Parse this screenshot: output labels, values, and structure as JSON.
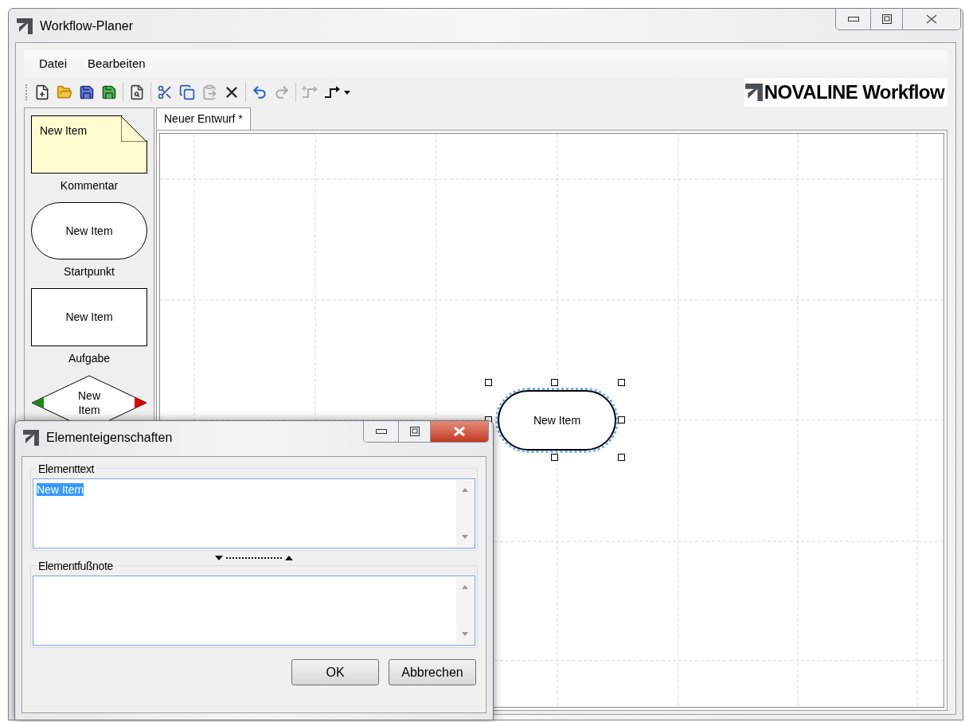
{
  "window": {
    "title": "Workflow-Planer"
  },
  "menu": [
    "Datei",
    "Bearbeiten"
  ],
  "toolbar": {
    "groups": [
      [
        {
          "kind": "new",
          "disabled": false
        },
        {
          "kind": "open",
          "disabled": false
        },
        {
          "kind": "save",
          "disabled": false
        },
        {
          "kind": "save-as",
          "disabled": false
        }
      ],
      [
        {
          "kind": "preview",
          "disabled": false
        }
      ],
      [
        {
          "kind": "cut",
          "disabled": false
        },
        {
          "kind": "copy",
          "disabled": false
        },
        {
          "kind": "paste",
          "disabled": true
        },
        {
          "kind": "delete",
          "disabled": false
        }
      ],
      [
        {
          "kind": "undo",
          "disabled": false
        },
        {
          "kind": "redo",
          "disabled": true
        }
      ],
      [
        {
          "kind": "connector-add",
          "disabled": true
        },
        {
          "kind": "connector",
          "disabled": false
        }
      ]
    ],
    "logo": "NOVALINE Workflow"
  },
  "palette": [
    {
      "kind": "comment",
      "text": "New Item",
      "label": "Kommentar"
    },
    {
      "kind": "start",
      "text": "New Item",
      "label": "Startpunkt"
    },
    {
      "kind": "task",
      "text": "New Item",
      "label": "Aufgabe"
    },
    {
      "kind": "decision",
      "text": "New Item"
    }
  ],
  "tabs": [
    {
      "label": "Neuer Entwurf *",
      "selected": true
    }
  ],
  "canvas": {
    "nodes": [
      {
        "kind": "start",
        "text": "New Item",
        "selected": true
      }
    ]
  },
  "dialog": {
    "title": "Elementeigenschaften",
    "fields": [
      {
        "label": "Elementtext",
        "value": "New Item",
        "highlighted": true
      },
      {
        "label": "Elementfußnote"
      }
    ],
    "buttons": [
      "OK",
      "Abbrechen"
    ]
  }
}
